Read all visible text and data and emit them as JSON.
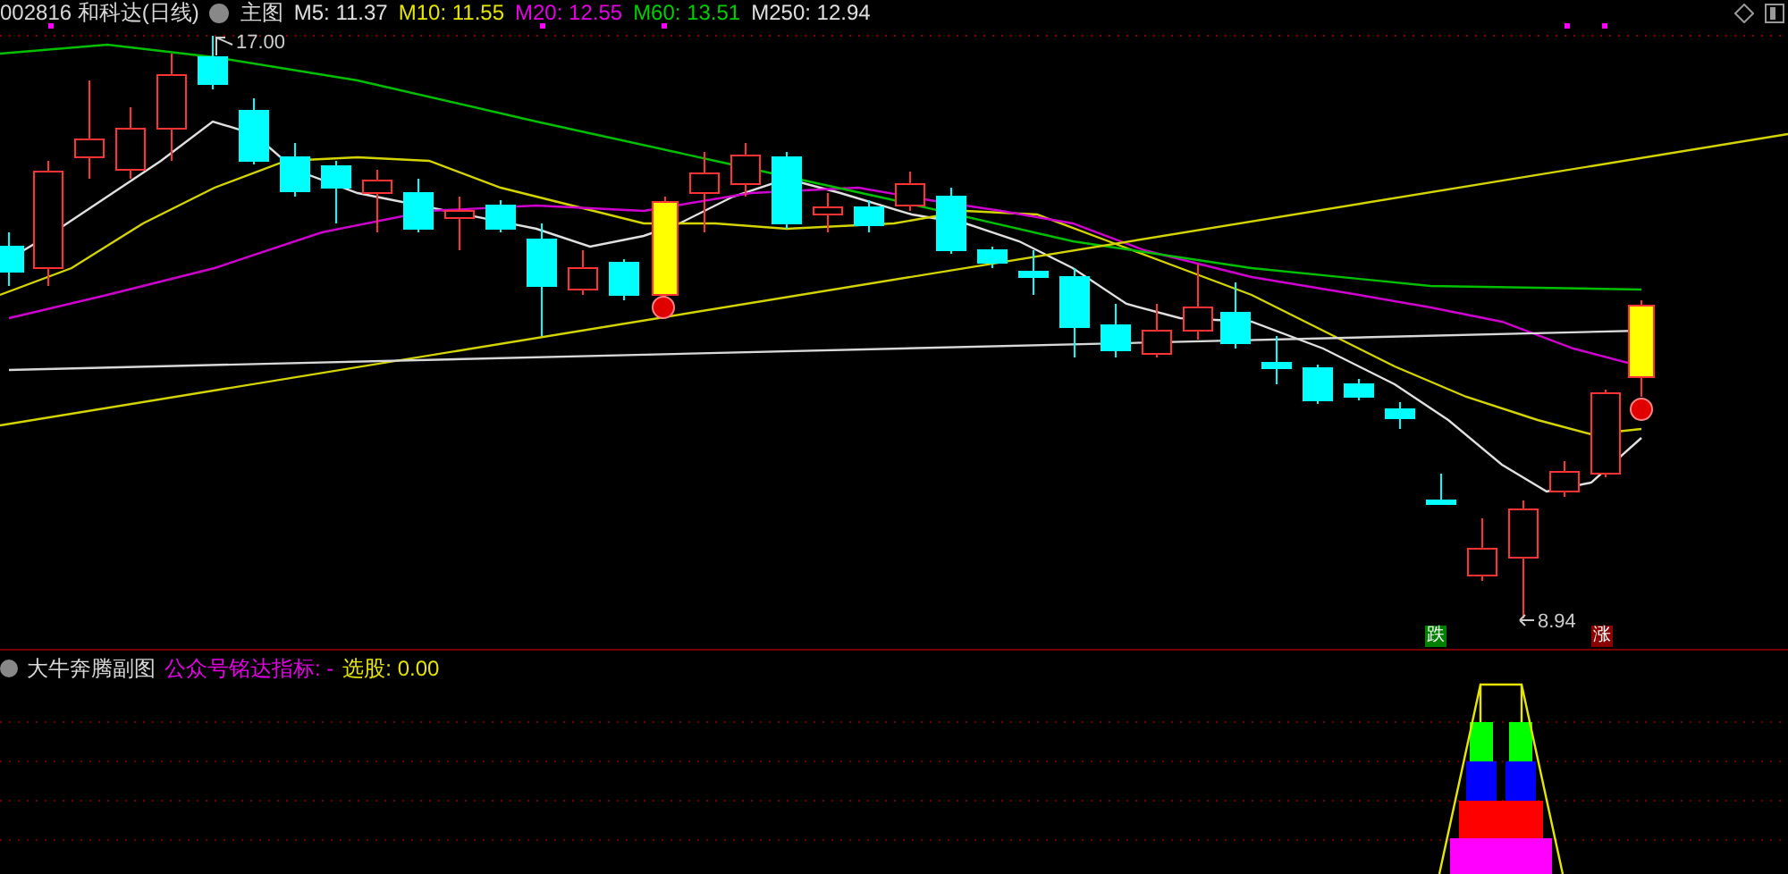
{
  "header": {
    "title": "002816 和科达(日线)",
    "chart_name": "主图",
    "averages": [
      {
        "label": "M5: 11.37",
        "color": "#e0e0e0"
      },
      {
        "label": "M10: 11.55",
        "color": "#e6e600"
      },
      {
        "label": "M20: 12.55",
        "color": "#e600e6"
      },
      {
        "label": "M60: 13.51",
        "color": "#00d000"
      },
      {
        "label": "M250: 12.94",
        "color": "#e0e0e0"
      }
    ]
  },
  "price_labels": {
    "high": "17.00",
    "low": "8.94"
  },
  "signals": [
    {
      "kind": "down",
      "text": "跌"
    },
    {
      "kind": "up",
      "text": "涨"
    }
  ],
  "sub_panel": {
    "title": "大牛奔腾副图",
    "indicator": "公众号铭达指标: -",
    "screen": "选股: 0.00"
  }
}
